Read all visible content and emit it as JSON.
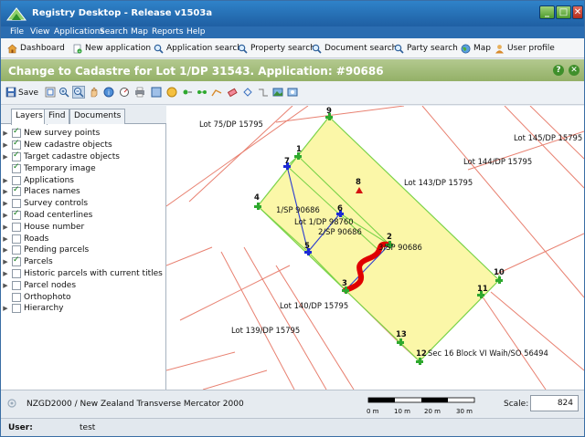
{
  "window": {
    "title": "Registry Desktop - Release v1503a",
    "buttons": {
      "minimize": "_",
      "maximize": "□",
      "close": "✕"
    }
  },
  "menubar": [
    "File",
    "View",
    "Applications",
    "Search",
    "Map",
    "Reports",
    "Help"
  ],
  "toolbar": {
    "dashboard": "Dashboard",
    "new_application": "New application",
    "application_search": "Application search",
    "property_search": "Property search",
    "document_search": "Document search",
    "party_search": "Party search",
    "map": "Map",
    "user_profile": "User profile"
  },
  "panel": {
    "title": "Change to Cadastre for Lot 1/DP 31543. Application: #90686",
    "help": "?",
    "close": "✕"
  },
  "map_toolbar": {
    "save_label": "Save"
  },
  "tabs": [
    {
      "label": "Layers",
      "active": true
    },
    {
      "label": "Find",
      "active": false
    },
    {
      "label": "Documents",
      "active": false
    }
  ],
  "layers": [
    {
      "label": "New survey points",
      "checked": true,
      "expandable": true
    },
    {
      "label": "New cadastre objects",
      "checked": true,
      "expandable": true
    },
    {
      "label": "Target cadastre objects",
      "checked": true,
      "expandable": true
    },
    {
      "label": "Temporary image",
      "checked": true,
      "expandable": false
    },
    {
      "label": "Applications",
      "checked": false,
      "expandable": true
    },
    {
      "label": "Places names",
      "checked": true,
      "expandable": true
    },
    {
      "label": "Survey controls",
      "checked": false,
      "expandable": true
    },
    {
      "label": "Road centerlines",
      "checked": true,
      "expandable": true
    },
    {
      "label": "House number",
      "checked": false,
      "expandable": true
    },
    {
      "label": "Roads",
      "checked": false,
      "expandable": true
    },
    {
      "label": "Pending parcels",
      "checked": false,
      "expandable": true
    },
    {
      "label": "Parcels",
      "checked": true,
      "expandable": true
    },
    {
      "label": "Historic parcels with current titles",
      "checked": false,
      "expandable": true
    },
    {
      "label": "Parcel nodes",
      "checked": false,
      "expandable": true
    },
    {
      "label": "Orthophoto",
      "checked": false,
      "expandable": false
    },
    {
      "label": "Hierarchy",
      "checked": false,
      "expandable": true
    }
  ],
  "map": {
    "lot_labels": [
      "Lot 75/DP 15795",
      "Lot 145/DP 15795",
      "Lot 144/DP 15795",
      "Lot 143/DP 15795",
      "1/SP 90686",
      "Lot 1/DP 98760",
      "2/SP 90686",
      "3/SP 90686",
      "Lot 140/DP 15795",
      "Lot 139/DP 15795",
      "Sec 16 Block VI Waih/SO 56494"
    ],
    "node_numbers": [
      "9",
      "1",
      "7",
      "8",
      "4",
      "6",
      "2",
      "5",
      "3",
      "10",
      "11",
      "13",
      "12"
    ],
    "colors": {
      "parcel_fill": "#fbf7a8",
      "parcel_line": "#7bd34a",
      "lot_line": "#e88070",
      "new_point": "#1c2ad6",
      "node_marker": "#2ea82e",
      "sketch": "#e00000",
      "target_point": "#d41010"
    }
  },
  "status": {
    "crs": "NZGD2000 / New Zealand Transverse Mercator 2000",
    "scale_ticks": [
      "0 m",
      "10 m",
      "20 m",
      "30 m"
    ],
    "scale_label": "Scale:",
    "scale_value": "824"
  },
  "userbar": {
    "label": "User:",
    "value": "test"
  }
}
